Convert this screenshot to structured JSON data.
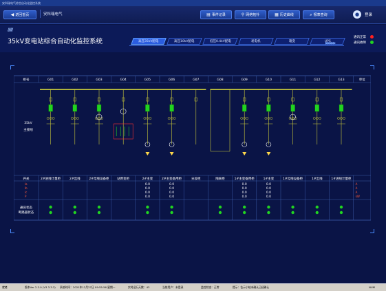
{
  "window": {
    "title": "安科瑞电气综合自动化监控系统"
  },
  "toolbar": {
    "home_label": "返回首页",
    "company": "安科瑞电气",
    "buttons": [
      {
        "label": "事件记录",
        "icon": "▤"
      },
      {
        "label": "网络拓扑",
        "icon": "⚲"
      },
      {
        "label": "历史曲线",
        "icon": "▦"
      },
      {
        "label": "报表查询",
        "icon": "⌕"
      }
    ],
    "login_label": "登录"
  },
  "header": {
    "stripes": "//////",
    "title": "35kV变电站综合自动化监控系统",
    "tabs": [
      "高压35kV配电",
      "高压10kV配电",
      "低压0.4kV配电",
      "发电机",
      "箱变",
      "UPS"
    ],
    "active_tab": 0,
    "status": [
      {
        "label": "通讯正常",
        "color": "#ff2020"
      },
      {
        "label": "通讯故障",
        "color": "#21d421"
      }
    ]
  },
  "diagram": {
    "header_label": "柜号",
    "unit_header": "单位",
    "columns": [
      {
        "id": "G01",
        "name": "2#进线计量柜"
      },
      {
        "id": "G02",
        "name": "2#出线"
      },
      {
        "id": "G03",
        "name": "2#母线设备柜"
      },
      {
        "id": "G04",
        "name": "站用变柜"
      },
      {
        "id": "G05",
        "name": "2#主变"
      },
      {
        "id": "G06",
        "name": "2#主变备用柜"
      },
      {
        "id": "G07",
        "name": "分段柜"
      },
      {
        "id": "G08",
        "name": "隔离柜"
      },
      {
        "id": "G09",
        "name": "1#主变备用柜"
      },
      {
        "id": "G10",
        "name": "1#主变"
      },
      {
        "id": "G11",
        "name": "1#母线设备柜"
      },
      {
        "id": "G12",
        "name": "1#出线"
      },
      {
        "id": "G13",
        "name": "1#进线计量柜"
      }
    ],
    "bus_label_1": "35kV",
    "bus_label_2": "主接线",
    "name_row_label": "开关",
    "meas_labels": [
      "Ia",
      "Ib",
      "Ic",
      "P"
    ],
    "units": [
      "A",
      "A",
      "A",
      "kW"
    ],
    "value_text": "0.0",
    "value_columns": [
      4,
      5,
      8,
      9
    ],
    "status_row_label_1": "通讯状态",
    "status_row_label_2": "断路器状态",
    "status_columns": [
      0,
      1,
      2,
      4,
      5,
      7,
      8,
      9,
      10,
      11,
      12
    ],
    "meter_columns": [
      0,
      1,
      2,
      4,
      5,
      8,
      9,
      10,
      11,
      12
    ],
    "transformer_columns": [
      4,
      5,
      8,
      9
    ],
    "status_colors": {
      "ok": "#21d421",
      "alarm": "#ff2020",
      "bus": "#e8e83a",
      "line": "#c9c93a"
    }
  },
  "statusbar": {
    "cells": [
      "就绪",
      "版本Ver 2.2.0 (V3 3.3.3)",
      "系统时间：2021年12月27日 09:55:56 星期一",
      "实时运行天数：43",
      "当前用户：未登录",
      "监控状态：正常",
      "提示：告示小结未确认已经确认",
      "NUM"
    ]
  }
}
